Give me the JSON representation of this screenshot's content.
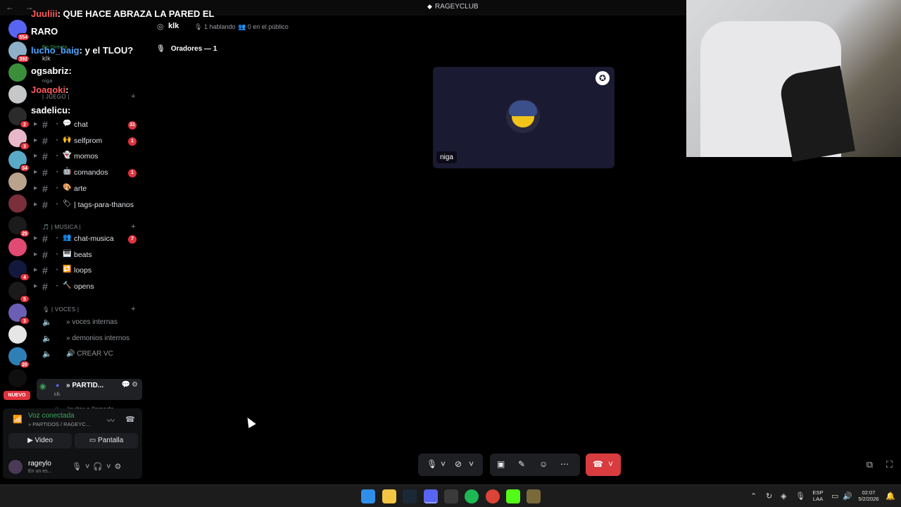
{
  "window": {
    "title": "RAGEYCLUB",
    "nav_glyphs": "← →"
  },
  "servers": [
    {
      "badge": "554",
      "color": "#5865f2"
    },
    {
      "badge": "392",
      "color": "#8fb0c8"
    },
    {
      "badge": "",
      "color": "#3b8f3b"
    },
    {
      "badge": "",
      "color": "#c6c7c9"
    },
    {
      "badge": "2",
      "color": "#2b2b2b"
    },
    {
      "badge": "3",
      "color": "#e8b7c9"
    },
    {
      "badge": "34",
      "color": "#59a9c7"
    },
    {
      "badge": "",
      "color": "#b9a38d"
    },
    {
      "badge": "",
      "color": "#7a2f3a"
    },
    {
      "badge": "25",
      "color": "#1b1b1b"
    },
    {
      "badge": "",
      "color": "#e04a73"
    },
    {
      "badge": "4",
      "color": "#13193d"
    },
    {
      "badge": "5",
      "color": "#1a1a1a"
    },
    {
      "badge": "3",
      "color": "#6b5fb5"
    },
    {
      "badge": "",
      "color": "#e6e6e6"
    },
    {
      "badge": "20",
      "color": "#2e7fb5"
    },
    {
      "badge": "",
      "color": "#0f0f0f"
    }
  ],
  "nuevo_label": "NUEVO",
  "overlay_chat": [
    {
      "user": "Juuliii",
      "text": ": QUE HACE ABRAZA LA PARED EL",
      "color": "r"
    },
    {
      "user": "",
      "text": "RARO",
      "color": ""
    },
    {
      "user": "lucho_baig",
      "text": ": y el TLOU?",
      "color": "u"
    },
    {
      "user": "ogsabriz",
      "text": ":",
      "color": ""
    },
    {
      "user": "Joaqoki",
      "text": ":",
      "color": "r"
    },
    {
      "user": "sadelicu",
      "text": ":",
      "color": ""
    }
  ],
  "sidebar": {
    "live_tag": "En Directo",
    "live_name": "klk",
    "live_sub": "niga",
    "category_juego": "| JUEGO |",
    "channels_top": [
      {
        "emoji": "💬",
        "name": "chat",
        "count": "31"
      },
      {
        "emoji": "🙌",
        "name": "selfprom",
        "count": "1"
      },
      {
        "emoji": "👻",
        "name": "momos",
        "count": ""
      },
      {
        "emoji": "🤖",
        "name": "comandos",
        "count": "1"
      },
      {
        "emoji": "🎨",
        "name": "arte",
        "count": ""
      },
      {
        "emoji": "🏷",
        "name": "| tags-para-thanos",
        "count": ""
      }
    ],
    "category_musica": "🎵 | MUSICA |",
    "channels_music": [
      {
        "emoji": "👥",
        "name": "chat-musica",
        "count": "7"
      },
      {
        "emoji": "🎹",
        "name": "beats",
        "count": ""
      },
      {
        "emoji": "🔁",
        "name": "loops",
        "count": ""
      },
      {
        "emoji": "🔨",
        "name": "opens",
        "count": ""
      }
    ],
    "category_voces": "🎙 | VOCES |",
    "voice_channels": [
      {
        "name": "» voces internas"
      },
      {
        "name": "» demonios internos"
      },
      {
        "name": "🔊 CREAR VC"
      }
    ],
    "active_voice": {
      "name": "» PARTID...",
      "sub": "klk"
    },
    "invite_label": "Invitar a llamada"
  },
  "voice_panel": {
    "status": "Voz conectada",
    "path": "» PARTIDOS / RAGEYC...",
    "video_label": "Video",
    "screen_label": "Pantalla"
  },
  "user": {
    "name": "rageylo",
    "status": "En un es..."
  },
  "stage": {
    "name": "klk",
    "speaking": "1 hablando",
    "audience": "0 en el público",
    "speakers_header": "Oradores — 1",
    "tile_label": "niga"
  },
  "taskbar": {
    "lang1": "ESP",
    "lang2": "LAA",
    "time": "02:07",
    "date": "5/2/2026"
  },
  "colors": {
    "accent_red": "#d83c3e",
    "connected_green": "#3ba55c",
    "badge_red": "#e0323d"
  }
}
